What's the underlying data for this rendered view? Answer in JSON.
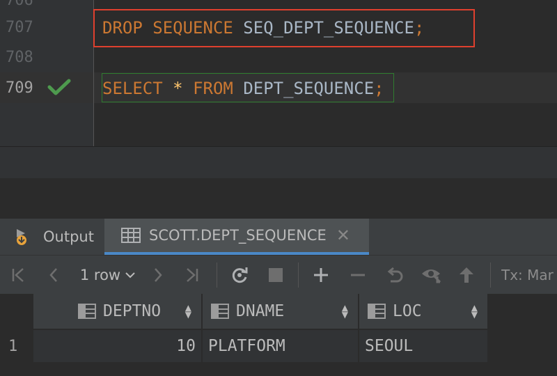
{
  "editor": {
    "lines": [
      {
        "number": "706",
        "text": ""
      },
      {
        "number": "707",
        "tokens": {
          "kw1": "DROP",
          "kw2": "SEQUENCE",
          "ident": "SEQ_DEPT_SEQUENCE",
          "semi": ";"
        }
      },
      {
        "number": "708",
        "text": ""
      },
      {
        "number": "709",
        "tokens": {
          "kw1": "SELECT",
          "op": "*",
          "kw2": "FROM",
          "ident": "DEPT_SEQUENCE",
          "semi": ";"
        }
      }
    ],
    "highlight_color": "#e0402e",
    "success_color": "#4e9a4e"
  },
  "tabs": [
    {
      "label": "Output",
      "icon": "output-icon",
      "active": false
    },
    {
      "label": "SCOTT.DEPT_SEQUENCE",
      "icon": "table-icon",
      "active": true,
      "close": "✕"
    }
  ],
  "toolbar": {
    "rows": "1 row",
    "tx": "Tx: Mar",
    "icons": [
      "first-page-icon",
      "prev-page-icon",
      "next-page-icon",
      "last-page-icon",
      "refresh-icon",
      "stop-icon",
      "add-row-icon",
      "delete-row-icon",
      "revert-icon",
      "view-icon",
      "submit-icon"
    ]
  },
  "grid": {
    "columns": [
      "DEPTNO",
      "DNAME",
      "LOC"
    ],
    "rows": [
      {
        "num": "1",
        "cells": [
          "10",
          "PLATFORM",
          "SEOUL"
        ]
      }
    ]
  }
}
